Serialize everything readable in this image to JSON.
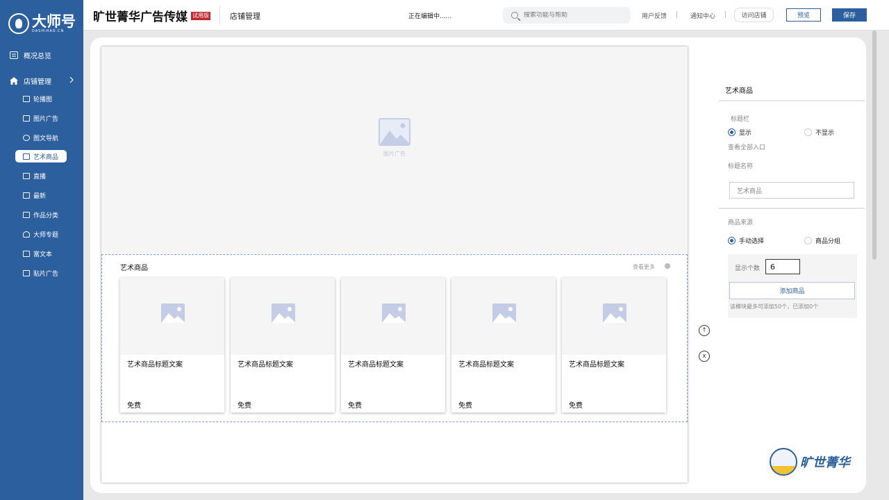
{
  "app": {
    "logo_text": "大师号",
    "logo_sub": "DASHIHAO.CN",
    "brand": "旷世菁华广告传媒",
    "trial_badge": "试用版",
    "section": "店铺管理",
    "status": "正在编辑中......"
  },
  "header": {
    "search_placeholder": "搜索功能与帮助",
    "feedback": "用户反馈",
    "notifications": "通知中心",
    "visit_store": "访问店铺",
    "preview": "预览",
    "save": "保存"
  },
  "sidebar": {
    "overview": "概况总览",
    "store_manage": "店铺管理",
    "items": [
      {
        "label": "轮播图",
        "icon": "monitor-icon"
      },
      {
        "label": "图片广告",
        "icon": "image-icon"
      },
      {
        "label": "图文导航",
        "icon": "compass-icon"
      },
      {
        "label": "艺术商品",
        "icon": "columns-icon",
        "active": true
      },
      {
        "label": "直播",
        "icon": "tv-icon"
      },
      {
        "label": "最新",
        "icon": "new-icon"
      },
      {
        "label": "作品分类",
        "icon": "category-icon"
      },
      {
        "label": "大师专题",
        "icon": "user-icon"
      },
      {
        "label": "富文本",
        "icon": "text-icon"
      },
      {
        "label": "贴片广告",
        "icon": "sticker-icon"
      }
    ]
  },
  "canvas": {
    "banner_caption": "图片广告",
    "module_title": "艺术商品",
    "view_more": "查看更多",
    "cards": [
      {
        "title": "艺术商品标题文案",
        "price": "免费"
      },
      {
        "title": "艺术商品标题文案",
        "price": "免费"
      },
      {
        "title": "艺术商品标题文案",
        "price": "免费"
      },
      {
        "title": "艺术商品标题文案",
        "price": "免费"
      },
      {
        "title": "艺术商品标题文案",
        "price": "免费"
      }
    ],
    "move_up_symbol": "↑",
    "close_symbol": "x"
  },
  "panel": {
    "title": "艺术商品",
    "title_bar_label": "标题栏",
    "show": "显示",
    "hide": "不显示",
    "view_all_entry": "查看全部入口",
    "title_name_label": "标题名称",
    "title_name_value": "艺术商品",
    "source_label": "商品来源",
    "manual_select": "手动选择",
    "product_group": "商品分组",
    "count_label": "显示个数",
    "count_value": "6",
    "add_product": "添加商品",
    "add_note": "该模块最多可添加50个，已添加0个"
  },
  "watermark": {
    "text": "旷世菁华"
  },
  "colors": {
    "primary": "#2c5f9e",
    "badge": "#c0262d"
  }
}
